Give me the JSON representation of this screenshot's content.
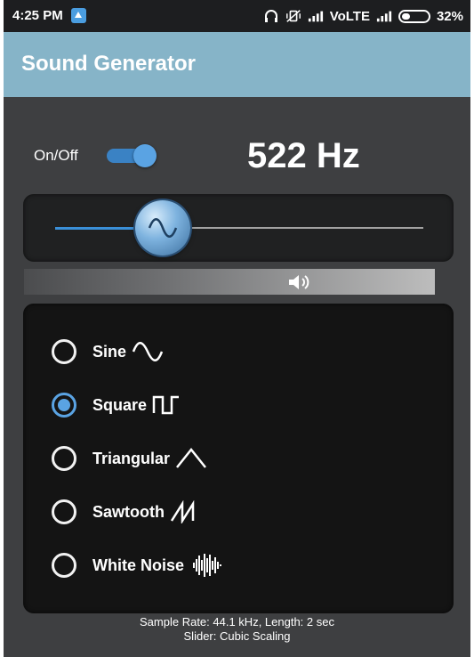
{
  "status_bar": {
    "time": "4:25 PM",
    "network_label": "VoLTE",
    "battery_percent": "32%",
    "battery_level": 0.32
  },
  "app_bar": {
    "title": "Sound Generator",
    "color": "#86b4c8"
  },
  "controls": {
    "onoff_label": "On/Off",
    "power_on": true,
    "frequency_display": "522 Hz",
    "slider_icon": "sine-wave-icon",
    "volume_icon": "speaker-icon"
  },
  "waveforms": {
    "options": [
      {
        "label": "Sine",
        "icon": "sine-wave-icon",
        "selected": false
      },
      {
        "label": "Square",
        "icon": "square-wave-icon",
        "selected": true
      },
      {
        "label": "Triangular",
        "icon": "triangle-wave-icon",
        "selected": false
      },
      {
        "label": "Sawtooth",
        "icon": "sawtooth-wave-icon",
        "selected": false
      },
      {
        "label": "White Noise",
        "icon": "noise-wave-icon",
        "selected": false
      }
    ]
  },
  "footer": {
    "line1": "Sample Rate: 44.1 kHz, Length: 2 sec",
    "line2": "Slider: Cubic Scaling"
  },
  "colors": {
    "accent": "#5aa3e3",
    "background": "#3e3f41",
    "panel": "#141414"
  }
}
